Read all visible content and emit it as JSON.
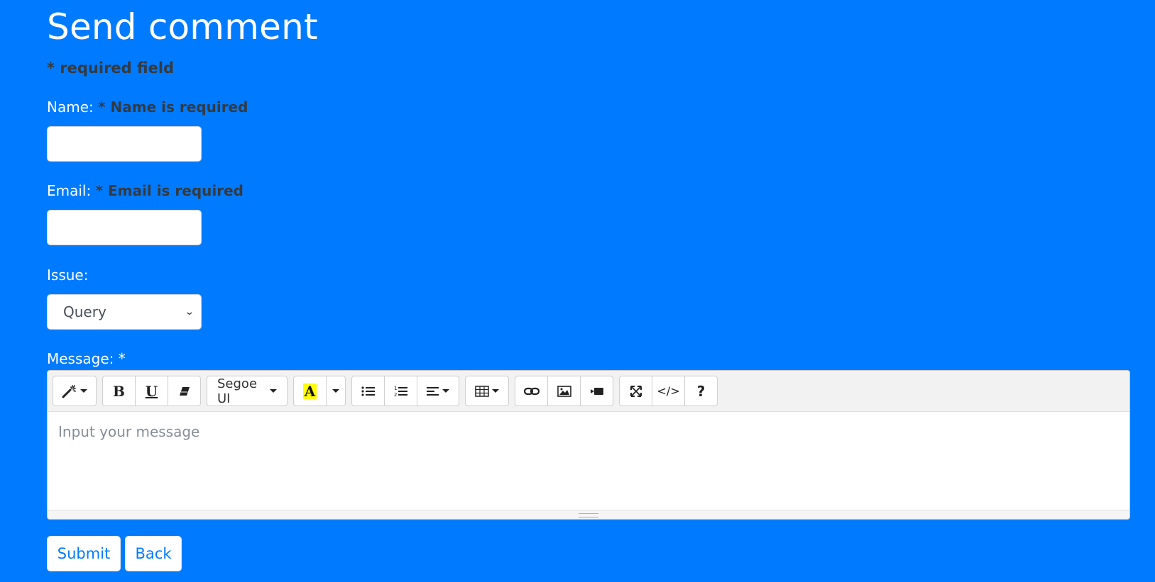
{
  "page": {
    "title": "Send comment",
    "required_note": "* required field"
  },
  "fields": {
    "name": {
      "label": "Name:",
      "error": "* Name is required",
      "value": ""
    },
    "email": {
      "label": "Email:",
      "error": "* Email is required",
      "value": ""
    },
    "issue": {
      "label": "Issue:",
      "selected": "Query"
    },
    "message": {
      "label": "Message: *",
      "placeholder": "Input your message"
    }
  },
  "toolbar": {
    "font_name": "Segoe UI",
    "highlight_letter": "A",
    "highlight_color": "#ffff00",
    "code_view_label": "</>",
    "help_label": "?",
    "icons": [
      "magic-icon",
      "bold-icon",
      "underline-icon",
      "eraser-icon",
      "font-name-dropdown",
      "highlight-icon",
      "color-dropdown-icon",
      "unordered-list-icon",
      "ordered-list-icon",
      "align-icon",
      "table-icon",
      "link-icon",
      "picture-icon",
      "video-icon",
      "fullscreen-icon",
      "code-view-icon",
      "help-icon"
    ]
  },
  "buttons": {
    "submit": "Submit",
    "back": "Back"
  },
  "colors": {
    "background": "#007bff",
    "error_text": "#343a40",
    "button_text": "#007bff"
  }
}
